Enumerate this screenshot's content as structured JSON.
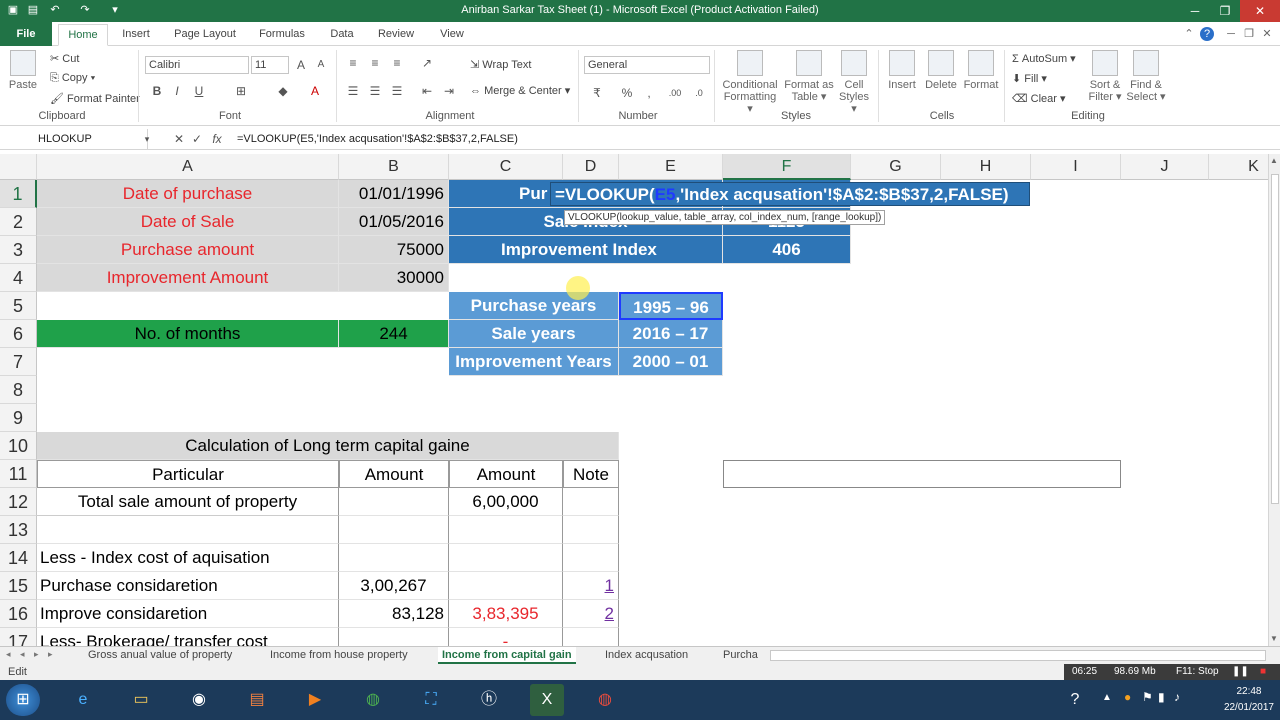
{
  "window": {
    "title": "Anirban Sarkar Tax Sheet (1) - Microsoft Excel (Product Activation Failed)",
    "minimize": "─",
    "restore": "❐",
    "close": "✕"
  },
  "tabs": [
    {
      "label": "File"
    },
    {
      "label": "Home"
    },
    {
      "label": "Insert"
    },
    {
      "label": "Page Layout"
    },
    {
      "label": "Formulas"
    },
    {
      "label": "Data"
    },
    {
      "label": "Review"
    },
    {
      "label": "View"
    }
  ],
  "ribbon": {
    "clipboard": {
      "paste": "Paste",
      "cut": "Cut",
      "copy": "Copy ▾",
      "format_painter": "Format Painter",
      "label": "Clipboard"
    },
    "font": {
      "name": "Calibri",
      "size": "11",
      "label": "Font"
    },
    "alignment": {
      "wrap": "Wrap Text",
      "merge": "Merge & Center ▾",
      "label": "Alignment"
    },
    "number": {
      "format": "General",
      "label": "Number"
    },
    "styles": {
      "conditional": "Conditional Formatting ▾",
      "format_table": "Format as Table ▾",
      "cell_styles": "Cell Styles ▾",
      "label": "Styles"
    },
    "cells": {
      "insert": "Insert",
      "delete": "Delete",
      "format": "Format",
      "label": "Cells"
    },
    "editing": {
      "autosum": "AutoSum ▾",
      "fill": "Fill ▾",
      "clear": "Clear ▾",
      "sort": "Sort & Filter ▾",
      "find": "Find & Select ▾",
      "label": "Editing"
    }
  },
  "formula_bar": {
    "name_box": "HLOOKUP",
    "formula": "=VLOOKUP(E5,'Index acqusation'!$A$2:$B$37,2,FALSE)"
  },
  "columns": [
    "A",
    "B",
    "C",
    "D",
    "E",
    "F",
    "G",
    "H",
    "I",
    "J",
    "K"
  ],
  "rows": [
    "1",
    "2",
    "3",
    "4",
    "5",
    "6",
    "7",
    "8",
    "9",
    "10",
    "11",
    "12",
    "13",
    "14",
    "15",
    "16",
    "17"
  ],
  "cells": {
    "a1": "Date of purchase",
    "b1": "01/01/1996",
    "a2": "Date of Sale",
    "b2": "01/05/2016",
    "a3": "Purchase amount",
    "b3": "75000",
    "a4": "Improvement Amount",
    "b4": "30000",
    "a6": "No. of months",
    "b6": "244",
    "c1": "Pur",
    "c2": "Sale Index",
    "c3": "Improvement Index",
    "f3": "406",
    "f2": "1125",
    "c5": "Purchase years",
    "e5": "1995 – 96",
    "c6": "Sale years",
    "e6": "2016 – 17",
    "c7": "Improvement Years",
    "e7": "2000 – 01",
    "a10": "Calculation of Long term capital gaine",
    "a11": "Particular",
    "b11": "Amount",
    "c11": "Amount",
    "d11": "Note",
    "a12": "Total sale amount of property",
    "c12": "6,00,000",
    "a14": "Less - Index cost of aquisation",
    "a15": "Purchase considaretion",
    "b15": "3,00,267",
    "d15": "1",
    "a16": "Improve considaretion",
    "b16": "83,128",
    "c16": "3,83,395",
    "d16": "2",
    "a17": "Less- Brokerage/ transfer cost",
    "c17": "-"
  },
  "editing_formula": {
    "prefix": "=VLOOKUP(",
    "ref": "E5",
    "rest": ",'Index acqusation'!$A$2:$B$37,2,FALSE)"
  },
  "tooltip": {
    "text": "VLOOKUP(lookup_value, table_array, col_index_num, [range_lookup])"
  },
  "sheets": [
    {
      "label": "Gross anual value of property"
    },
    {
      "label": "Income from house property"
    },
    {
      "label": "Income from capital gain"
    },
    {
      "label": "Index acqusation"
    },
    {
      "label": "Purcha"
    }
  ],
  "status": {
    "mode": "Edit",
    "recorder_time": "06:25",
    "recorder_size": "98.69 Mb",
    "recorder_stop": "F11: Stop"
  },
  "taskbar": {
    "time": "22:48",
    "date": "22/01/2017"
  },
  "colors": {
    "excel_green": "#217346",
    "header_blue": "#2e75b6",
    "light_blue": "#5b9bd5",
    "green_fill": "#1fa14a",
    "red_text": "#e8262c"
  }
}
